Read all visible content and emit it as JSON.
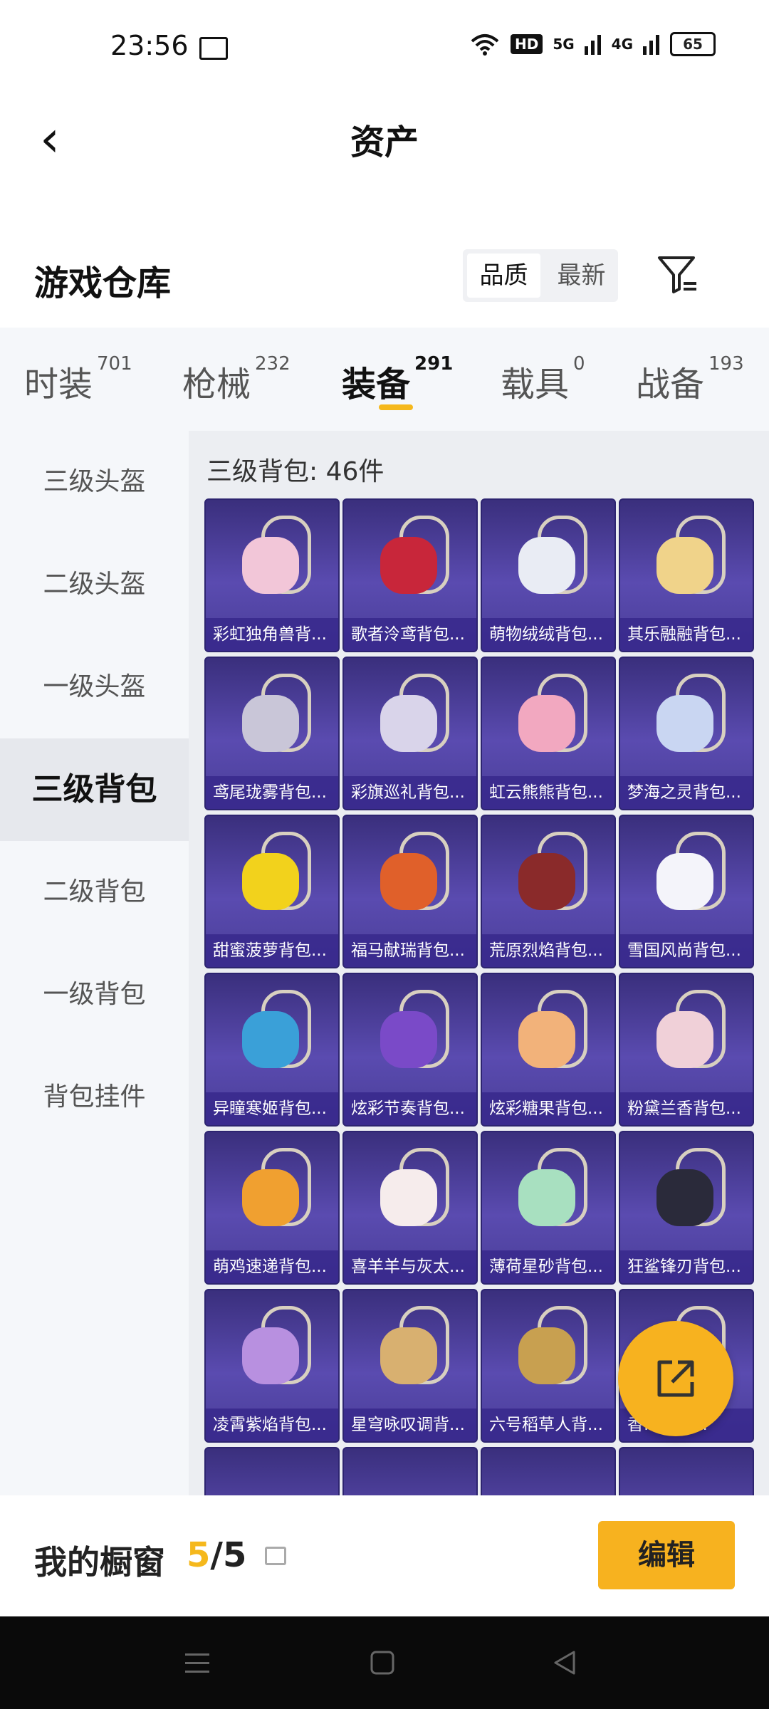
{
  "status_bar": {
    "time": "23:56",
    "hd": "HD",
    "net1": "5G",
    "net2": "4G",
    "battery": "65"
  },
  "header": {
    "title": "资产"
  },
  "warehouse": {
    "title": "游戏仓库",
    "sort_options": [
      "品质",
      "最新"
    ]
  },
  "tabs": [
    {
      "label": "时装",
      "count": "701"
    },
    {
      "label": "枪械",
      "count": "232"
    },
    {
      "label": "装备",
      "count": "291"
    },
    {
      "label": "载具",
      "count": "0"
    },
    {
      "label": "战备",
      "count": "193"
    }
  ],
  "sidebar": [
    {
      "label": "三级头盔"
    },
    {
      "label": "二级头盔"
    },
    {
      "label": "一级头盔"
    },
    {
      "label": "三级背包"
    },
    {
      "label": "二级背包"
    },
    {
      "label": "一级背包"
    },
    {
      "label": "背包挂件"
    }
  ],
  "content": {
    "title": "三级背包: 46件"
  },
  "items": [
    {
      "name": "彩虹独角兽背...",
      "color": "#f2c6d8"
    },
    {
      "name": "歌者泠鸢背包...",
      "color": "#c8263a"
    },
    {
      "name": "萌物绒绒背包...",
      "color": "#e9ecf4"
    },
    {
      "name": "其乐融融背包...",
      "color": "#f0d38a"
    },
    {
      "name": "鸢尾珑雾背包...",
      "color": "#c9c6d8"
    },
    {
      "name": "彩旗巡礼背包...",
      "color": "#d9d4ea"
    },
    {
      "name": "虹云熊熊背包...",
      "color": "#f2a8c0"
    },
    {
      "name": "梦海之灵背包...",
      "color": "#c9d6f2"
    },
    {
      "name": "甜蜜菠萝背包...",
      "color": "#f2d21c"
    },
    {
      "name": "福马献瑞背包...",
      "color": "#e0602a"
    },
    {
      "name": "荒原烈焰背包...",
      "color": "#8a2a2a"
    },
    {
      "name": "雪国风尚背包...",
      "color": "#f4f4fa"
    },
    {
      "name": "异瞳寒姬背包...",
      "color": "#3aa0d8"
    },
    {
      "name": "炫彩节奏背包...",
      "color": "#7a4ac8"
    },
    {
      "name": "炫彩糖果背包...",
      "color": "#f2b27a"
    },
    {
      "name": "粉黛兰香背包...",
      "color": "#f0d0d8"
    },
    {
      "name": "萌鸡速递背包...",
      "color": "#f0a030"
    },
    {
      "name": "喜羊羊与灰太...",
      "color": "#f6ecec"
    },
    {
      "name": "薄荷星砂背包...",
      "color": "#a8e0c0"
    },
    {
      "name": "狂鲨锋刃背包...",
      "color": "#2a2a3a"
    },
    {
      "name": "凌霄紫焰背包...",
      "color": "#b890e0"
    },
    {
      "name": "星穹咏叹调背...",
      "color": "#d8b070"
    },
    {
      "name": "六号稻草人背...",
      "color": "#c8a050"
    },
    {
      "name": "香...背包...",
      "color": "#7060c0"
    }
  ],
  "showcase": {
    "label": "我的橱窗",
    "current": "5",
    "total": "/5",
    "edit_label": "编辑"
  }
}
